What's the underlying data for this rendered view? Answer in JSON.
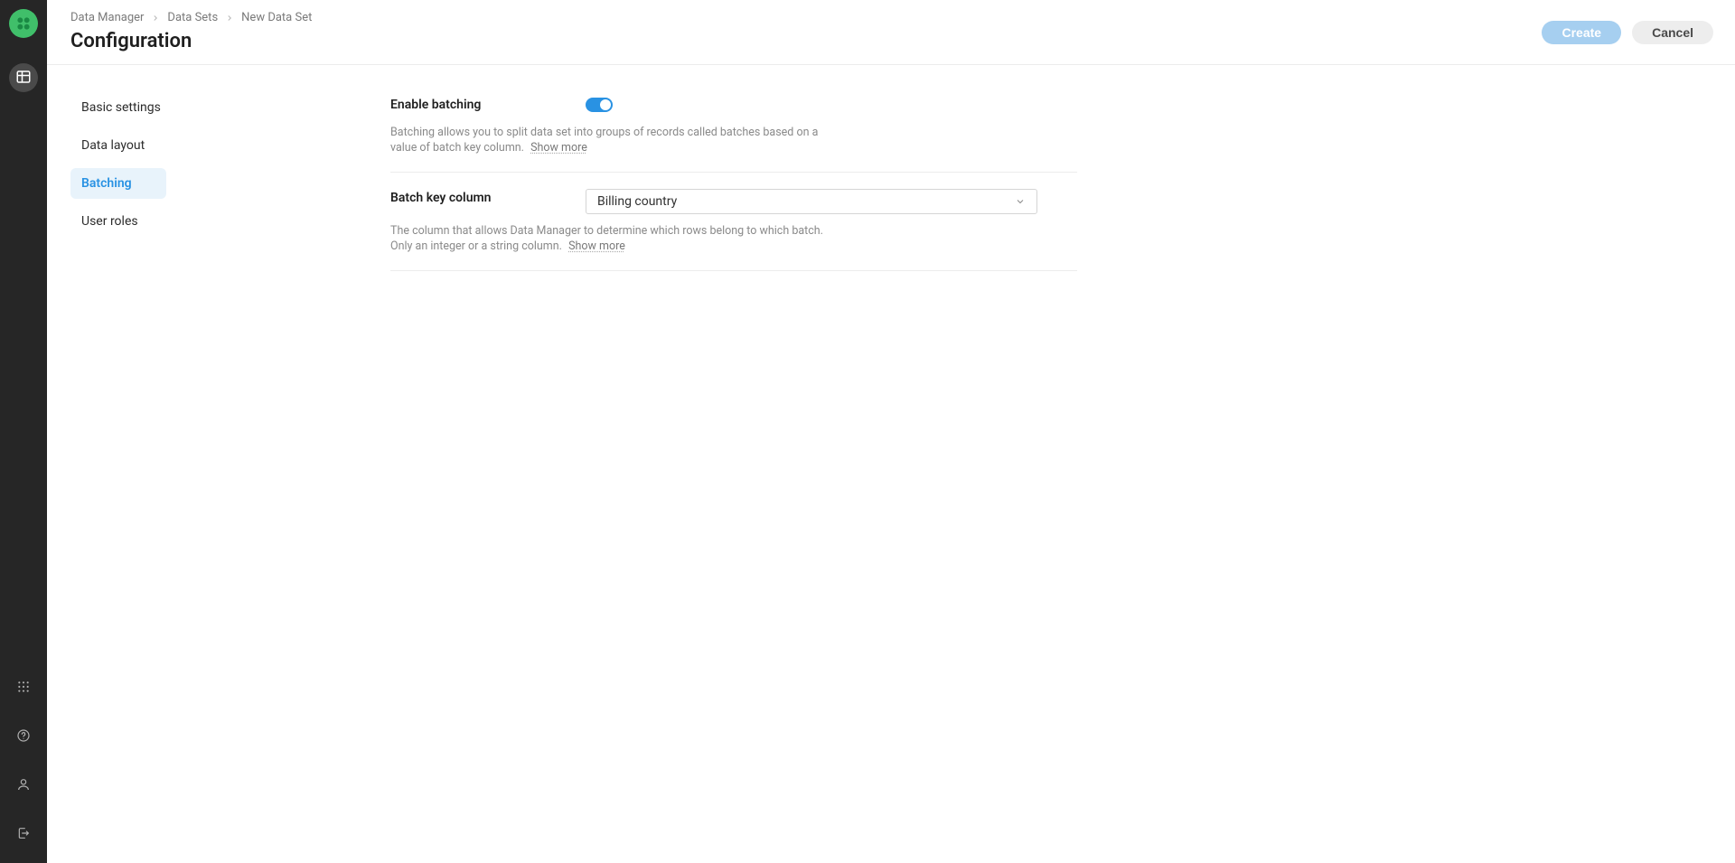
{
  "breadcrumb": {
    "items": [
      "Data Manager",
      "Data Sets",
      "New Data Set"
    ]
  },
  "page": {
    "title": "Configuration"
  },
  "actions": {
    "create": "Create",
    "cancel": "Cancel"
  },
  "subnav": {
    "items": [
      {
        "label": "Basic settings"
      },
      {
        "label": "Data layout"
      },
      {
        "label": "Batching"
      },
      {
        "label": "User roles"
      }
    ],
    "active_index": 2
  },
  "batching": {
    "enable_label": "Enable batching",
    "enable_value": true,
    "enable_help": "Batching allows you to split data set into groups of records called batches based on a value of batch key column.",
    "show_more": "Show more",
    "key_label": "Batch key column",
    "key_value": "Billing country",
    "key_help": "The column that allows Data Manager to determine which rows belong to which batch. Only an integer or a string column."
  },
  "rail": {
    "icons": {
      "datasets": "table-icon",
      "apps": "apps-icon",
      "help": "help-icon",
      "user": "user-icon",
      "logout": "logout-icon"
    }
  }
}
